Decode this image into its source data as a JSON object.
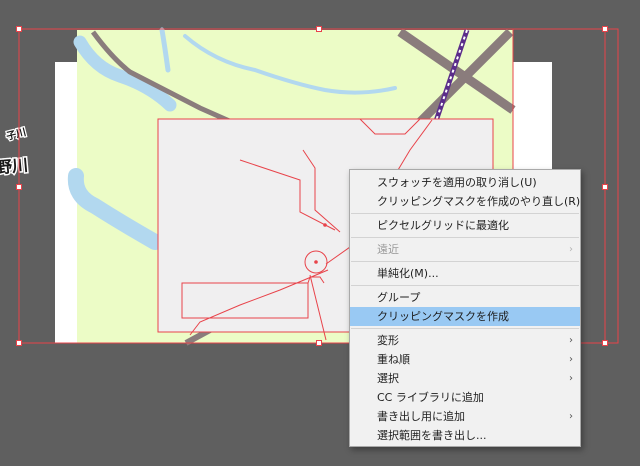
{
  "artwork": {
    "labels": [
      "子川",
      "野川"
    ],
    "colors": {
      "workspace": "#5f5f5f",
      "artboard": "#ffffff",
      "map_fill": "#ecfcc6",
      "river": "#b2d8ef",
      "road": "#8a7c7c",
      "railway": "#5b2d8a",
      "clip_rect": "#f0eff0",
      "selection": "#e8434a"
    }
  },
  "context_menu": {
    "items": [
      {
        "label": "スウォッチを適用の取り消し(U)",
        "state": "normal",
        "submenu": false
      },
      {
        "label": "クリッピングマスクを作成のやり直し(R)",
        "state": "normal",
        "submenu": false
      },
      {
        "separator": true
      },
      {
        "label": "ピクセルグリッドに最適化",
        "state": "normal",
        "submenu": false
      },
      {
        "separator": true
      },
      {
        "label": "遠近",
        "state": "disabled",
        "submenu": true
      },
      {
        "separator": true
      },
      {
        "label": "単純化(M)...",
        "state": "normal",
        "submenu": false
      },
      {
        "separator": true
      },
      {
        "label": "グループ",
        "state": "normal",
        "submenu": false
      },
      {
        "label": "クリッピングマスクを作成",
        "state": "highlighted",
        "submenu": false
      },
      {
        "separator": true
      },
      {
        "label": "変形",
        "state": "normal",
        "submenu": true
      },
      {
        "label": "重ね順",
        "state": "normal",
        "submenu": true
      },
      {
        "label": "選択",
        "state": "normal",
        "submenu": true
      },
      {
        "label": "CC ライブラリに追加",
        "state": "normal",
        "submenu": false
      },
      {
        "label": "書き出し用に追加",
        "state": "normal",
        "submenu": true
      },
      {
        "label": "選択範囲を書き出し...",
        "state": "normal",
        "submenu": false
      }
    ],
    "submenu_glyph": "›"
  }
}
